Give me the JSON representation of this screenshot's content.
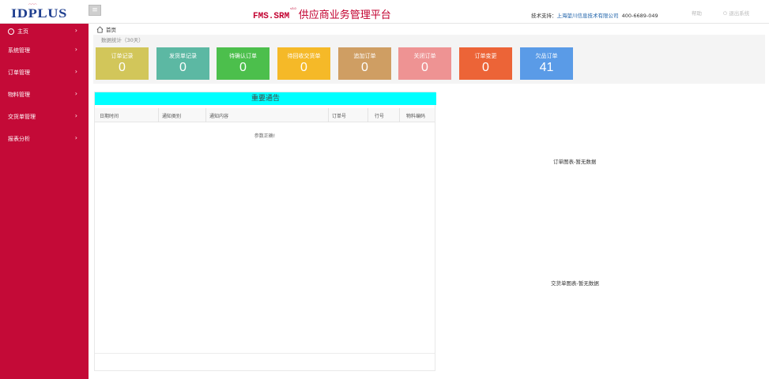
{
  "header": {
    "logo_text": "IDPLUS",
    "brand_code": "FMS.SRM",
    "brand_ver": "v3.0",
    "brand_name": "供应商业务管理平台",
    "support_label": "技术支持：",
    "support_company": "上海堃川信息技术有限公司",
    "support_phone": "400-6689-049",
    "link_help": "帮助",
    "link_logout": "退出系统"
  },
  "sidebar": {
    "items": [
      {
        "label": "主页"
      },
      {
        "label": "系统管理"
      },
      {
        "label": "订单管理"
      },
      {
        "label": "物料管理"
      },
      {
        "label": "交货单管理"
      },
      {
        "label": "报表分析"
      }
    ]
  },
  "breadcrumb": {
    "home": "首页"
  },
  "stats": {
    "title": "数据统计（30天）",
    "cards": [
      {
        "label": "订单记录",
        "value": "0",
        "color": "#d2c65a"
      },
      {
        "label": "发货单记录",
        "value": "0",
        "color": "#5cb8a3"
      },
      {
        "label": "待确认订单",
        "value": "0",
        "color": "#4cbf4c"
      },
      {
        "label": "待回收交货单",
        "value": "0",
        "color": "#f5b928"
      },
      {
        "label": "追加订单",
        "value": "0",
        "color": "#cf9e63"
      },
      {
        "label": "关闭订单",
        "value": "0",
        "color": "#ee9393"
      },
      {
        "label": "订单变更",
        "value": "0",
        "color": "#ec6437"
      },
      {
        "label": "欠品订单",
        "value": "41",
        "color": "#5a9be7"
      }
    ]
  },
  "notice": {
    "title": "重要通告",
    "columns": [
      "日期时间",
      "通知类别",
      "通知内容",
      "订单号",
      "行号",
      "物料编码"
    ],
    "empty_text": "参数正确!"
  },
  "charts": {
    "order_msg": "订单图表-暂无数据",
    "delivery_msg": "交货单图表-暂无数据"
  }
}
